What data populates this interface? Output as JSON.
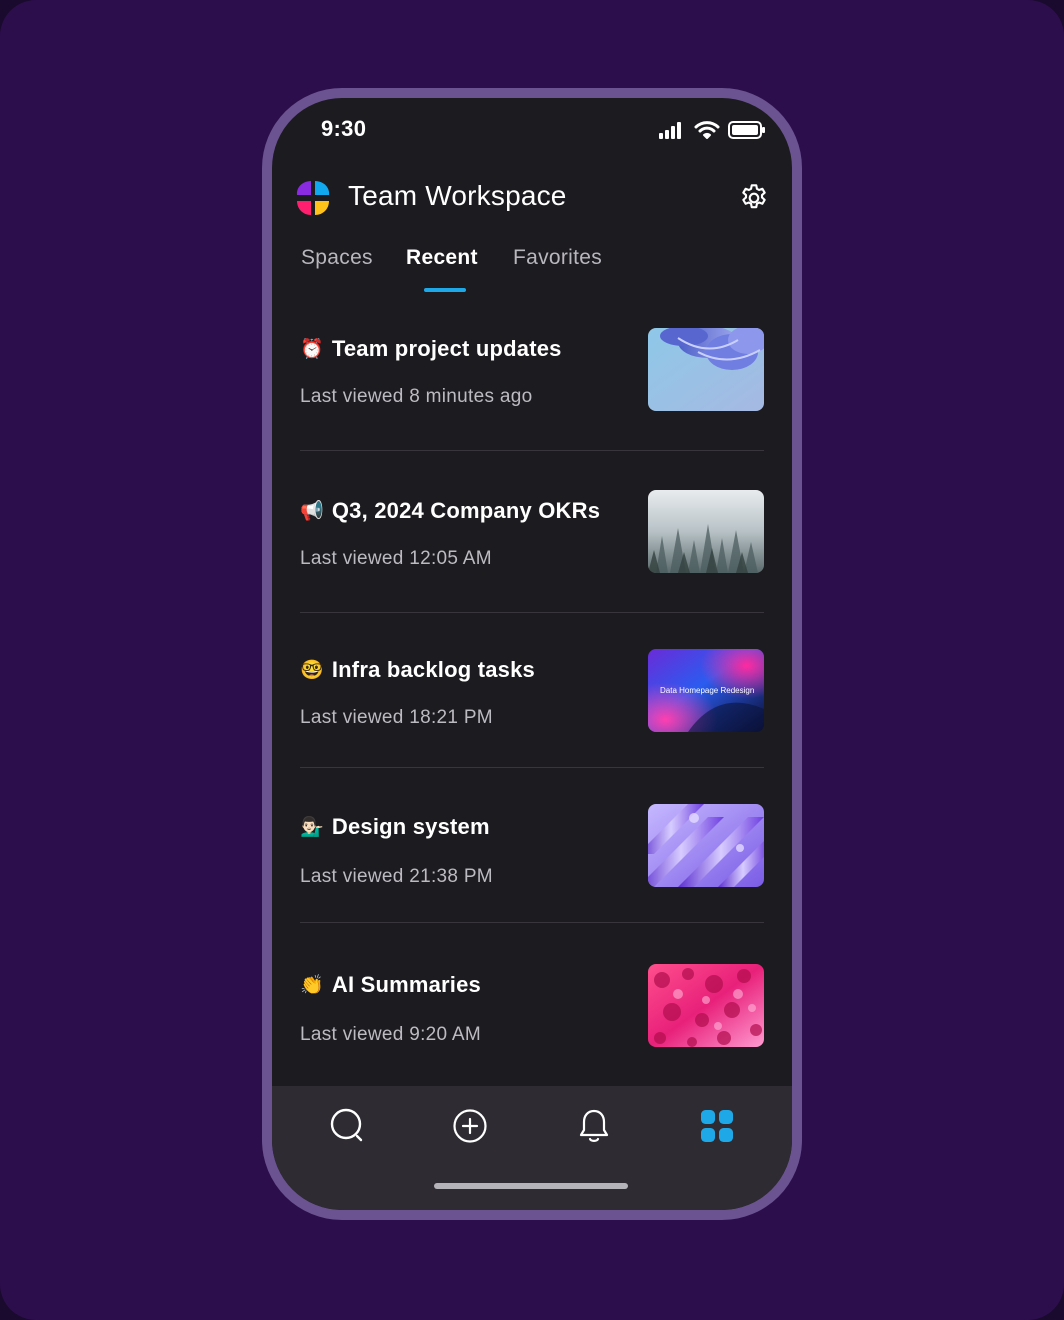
{
  "status": {
    "time": "9:30"
  },
  "header": {
    "title": "Team Workspace"
  },
  "tabs": [
    {
      "label": "Spaces",
      "active": false
    },
    {
      "label": "Recent",
      "active": true
    },
    {
      "label": "Favorites",
      "active": false
    }
  ],
  "items": [
    {
      "emoji": "⏰",
      "emoji_name": "alarm-clock-icon",
      "title": "Team project updates",
      "subtitle": "Last viewed 8 minutes ago",
      "thumb": "blue-abstract-shapes"
    },
    {
      "emoji": "📢",
      "emoji_name": "megaphone-icon",
      "title": "Q3, 2024 Company OKRs",
      "subtitle": "Last viewed 12:05 AM",
      "thumb": "snowy-forest"
    },
    {
      "emoji": "🤓",
      "emoji_name": "nerd-face-icon",
      "title": "Infra backlog tasks",
      "subtitle": "Last viewed 18:21 PM",
      "thumb": "gradient-cover",
      "thumb_text": "Data Homepage Redesign"
    },
    {
      "emoji": "💁🏻‍♂️",
      "emoji_name": "person-tipping-hand-icon",
      "title": "Design system",
      "subtitle": "Last viewed 21:38 PM",
      "thumb": "purple-3d-shapes"
    },
    {
      "emoji": "👏",
      "emoji_name": "clapping-hands-icon",
      "title": "AI Summaries",
      "subtitle": "Last viewed 9:20 AM",
      "thumb": "pink-coral-texture"
    }
  ],
  "bottom_nav": [
    {
      "name": "search-icon",
      "active": false
    },
    {
      "name": "add-icon",
      "active": false
    },
    {
      "name": "bell-icon",
      "active": false
    },
    {
      "name": "grid-icon",
      "active": true
    }
  ],
  "colors": {
    "background": "#2d0e4d",
    "phone_frame": "#6a5390",
    "screen": "#1c1b1f",
    "accent": "#1fa8e8",
    "bottom_bar": "#2e2b33"
  }
}
